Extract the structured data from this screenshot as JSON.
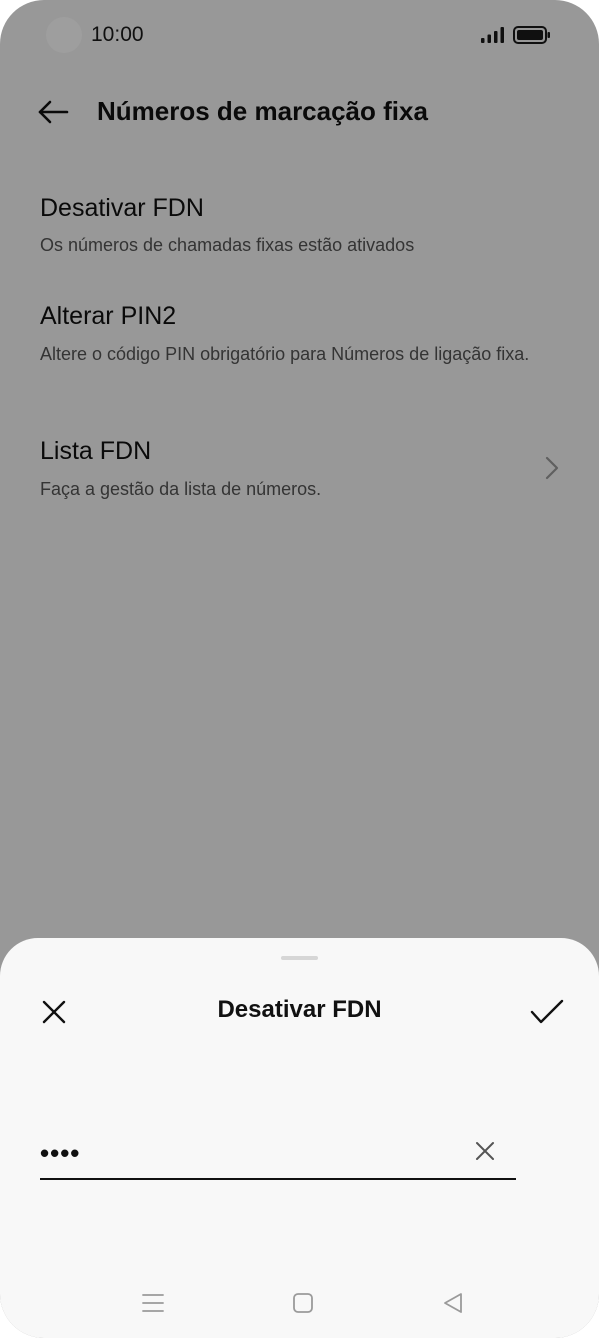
{
  "status_bar": {
    "time": "10:00",
    "icons": [
      "camera-cutout",
      "signal-icon",
      "battery-icon"
    ]
  },
  "header": {
    "title": "Números de marcação fixa",
    "back_icon": "back-arrow-icon"
  },
  "settings": {
    "items": [
      {
        "title": "Desativar FDN",
        "subtitle": "Os números de chamadas fixas estão ativados"
      },
      {
        "title": "Alterar PIN2",
        "subtitle": "Altere o código PIN obrigatório para Números de ligação fixa."
      },
      {
        "title": "Lista FDN",
        "subtitle": "Faça a gestão da lista de números.",
        "icon": "chevron-right-icon"
      }
    ]
  },
  "dialog": {
    "title": "Desativar FDN",
    "close_icon": "close-icon",
    "confirm_icon": "checkmark-icon",
    "pin_field": {
      "value": "••••",
      "clear_icon": "clear-icon"
    }
  },
  "nav_bar": {
    "icons": [
      "menu-icon",
      "home-icon",
      "back-triangle-icon"
    ]
  },
  "colors": {
    "background": "#f5f5f5",
    "sheet": "#f8f8f8",
    "text": "#111111",
    "subtext": "#555555",
    "scrim": "rgba(0,0,0,0.38)"
  }
}
